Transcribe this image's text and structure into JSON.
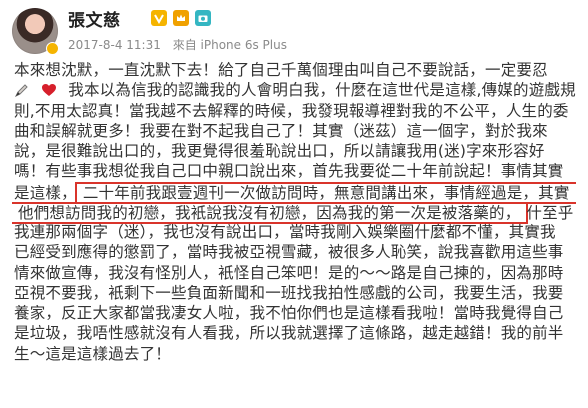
{
  "header": {
    "username": "張文慈",
    "timestamp": "2017-8-4 11:31",
    "source": "來自 iPhone 6s Plus",
    "badges": [
      "vip-icon",
      "crown-icon",
      "camera-icon"
    ]
  },
  "post": {
    "lines": [
      "本來想沈默，一直沈默下去！給了自己千萬個理由叫自己不要說話，一定要忍",
      "我本以為信我的認識我的人會明白我，什麼在這世代是這樣,傳媒的遊戲規",
      "則,不用太認真！當我越不去解釋的時候，我發現報導裡對我的不公平，人生的委",
      "曲和誤解就更多！我要在對不起我自己了！其實（迷茲）這一個字，對於我來",
      "說，是很難說出口的，我更覺得很羞恥說出口，所以請讓我用(迷)字來形容好",
      "嗎！有些事我想從我自己口中親口說出來，首先我要從二十年前說起！事情其實",
      "是這樣，",
      "二十年前我跟壹週刊一次做訪問時，無意間講出來，事情經過是，其實",
      "他們想訪問我的初戀，我衹說我沒有初戀，因為我的第一次是被落藥的，",
      "什至乎",
      "我連那兩個字（迷），我也沒有說出口，當時我剛入娛樂圈什麼都不懂，其實我",
      "已經受到應得的懲罰了，當時我被亞視雪藏，被很多人恥笑，說我喜歡用這些事",
      "情來做宣傳，我沒有怪別人，衹怪自己笨吧！是的～～路是自己揀的，因為那時",
      "亞視不要我，衹剩下一些負面新聞和一班找我拍性感戲的公司，我要生活，我要",
      "養家，反正大家都當我凄女人啦，我不怕你們也是這樣看我啦！當時我覺得自己",
      "是垃圾，我唔性感就沒有人看我，所以我就選擇了這條路，越走越錯！我的前半",
      "生～這是這樣過去了！"
    ]
  },
  "colors": {
    "highlight_border": "#d9342b",
    "text": "#333333",
    "meta": "#8a8a8a",
    "vip": "#f5b400"
  }
}
